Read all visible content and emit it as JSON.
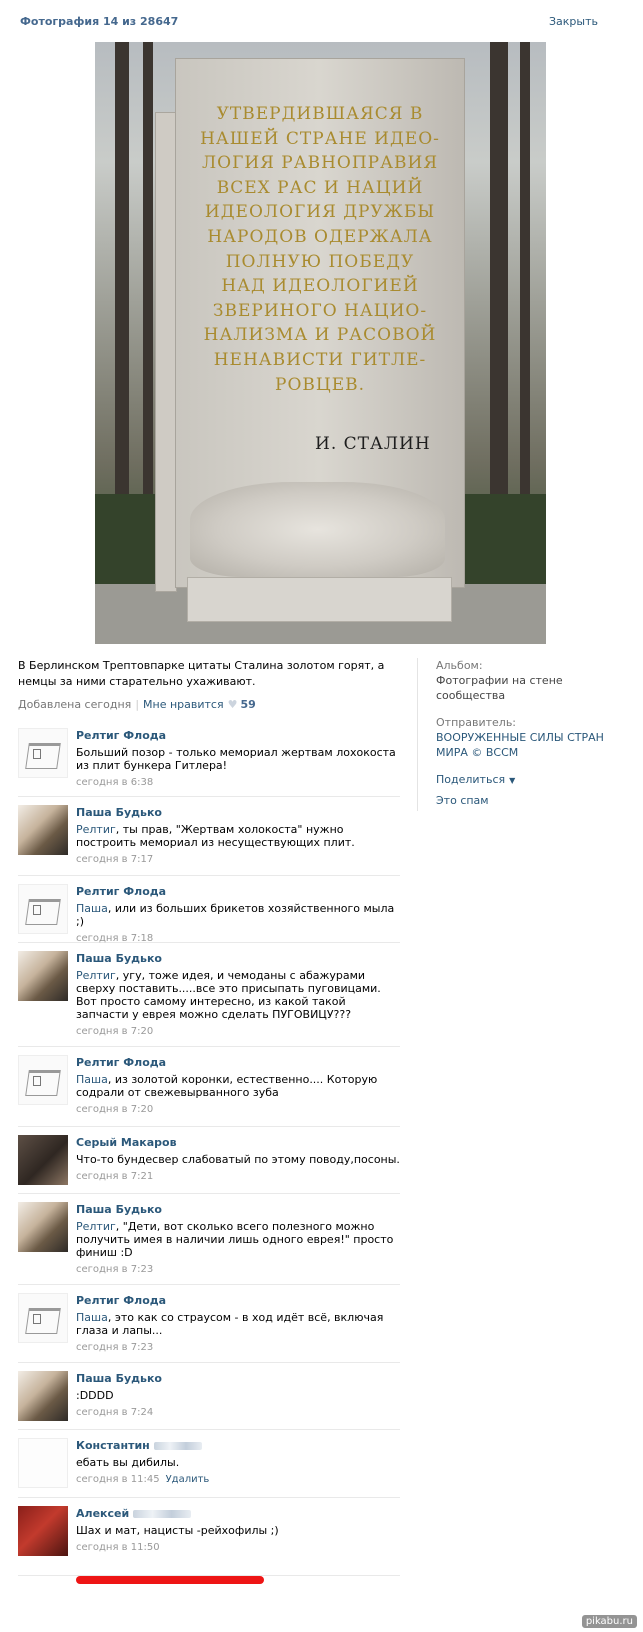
{
  "header": {
    "title": "Фотография 14 из 28647",
    "close": "Закрыть"
  },
  "photo": {
    "inscription": [
      "УТВЕРДИВШАЯСЯ В",
      "НАШЕЙ СТРАНЕ ИДЕО-",
      "ЛОГИЯ РАВНОПРАВИЯ",
      "ВСЕХ РАС И НАЦИЙ",
      "ИДЕОЛОГИЯ ДРУЖБЫ",
      "НАРОДОВ ОДЕРЖАЛА",
      "ПОЛНУЮ ПОБЕДУ",
      "НАД ИДЕОЛОГИЕЙ",
      "ЗВЕРИНОГО НАЦИО-",
      "НАЛИЗМА И РАСОВОЙ",
      "НЕНАВИСТИ ГИТЛЕ-",
      "РОВЦЕВ."
    ],
    "signature": "И. СТАЛИН"
  },
  "description": "В Берлинском Трептовпарке цитаты Сталина золотом горят, а немцы за ними старательно ухаживают.",
  "meta": {
    "added": "Добавлена сегодня",
    "like": "Мне нравится",
    "likes": "59"
  },
  "sidebar": {
    "album_label": "Альбом:",
    "album_value": "Фотографии на стене сообщества",
    "sender_label": "Отправитель:",
    "sender_value": "ВООРУЖЕННЫЕ СИЛЫ СТРАН МИРА © ВССМ",
    "share": "Поделиться",
    "spam": "Это спам"
  },
  "comments": [
    {
      "author": "Релтиг Флода",
      "reply": "",
      "text": "Больший позор - только мемориал жертвам лохокоста из плит бункера Гитлера!",
      "time": "сегодня в 6:38"
    },
    {
      "author": "Паша Будько",
      "reply": "Релтиг",
      "text": ", ты прав, \"Жертвам холокоста\" нужно построить мемориал из несуществующих плит.",
      "time": "сегодня в 7:17"
    },
    {
      "author": "Релтиг Флода",
      "reply": "Паша",
      "text": ", или из больших брикетов хозяйственного мыла ;)",
      "time": "сегодня в 7:18"
    },
    {
      "author": "Паша Будько",
      "reply": "Релтиг",
      "text": ", угу, тоже идея, и чемоданы с абажурами сверху поставить.....все это присыпать пуговицами. Вот просто самому интересно, из какой такой запчасти у еврея можно сделать ПУГОВИЦУ???",
      "time": "сегодня в 7:20"
    },
    {
      "author": "Релтиг Флода",
      "reply": "Паша",
      "text": ", из золотой коронки, естественно.... Которую содрали от свежевырванного зуба",
      "time": "сегодня в 7:20"
    },
    {
      "author": "Серый Макаров",
      "reply": "",
      "text": "Что-то бундесвер слабоватый по этому поводу,посоны.",
      "time": "сегодня в 7:21"
    },
    {
      "author": "Паша Будько",
      "reply": "Релтиг",
      "text": ", \"Дети, вот сколько всего полезного можно получить имея в наличии лишь одного еврея!\" просто финиш :D",
      "time": "сегодня в 7:23"
    },
    {
      "author": "Релтиг Флода",
      "reply": "Паша",
      "text": ", это как со страусом - в ход идёт всё, включая глаза и лапы...",
      "time": "сегодня в 7:23"
    },
    {
      "author": "Паша Будько",
      "reply": "",
      "text": ":DDDD",
      "time": "сегодня в 7:24"
    },
    {
      "author": "Константин",
      "reply": "",
      "text": "ебать вы дибилы.",
      "time": "сегодня в 11:45",
      "delete": "Удалить"
    },
    {
      "author": "Алексей",
      "reply": "",
      "text": "Шах и мат, нацисты -рейхофилы ;)",
      "time": "сегодня в 11:50"
    }
  ],
  "watermark": "pikabu.ru"
}
